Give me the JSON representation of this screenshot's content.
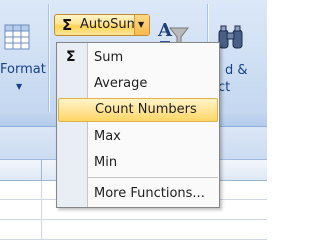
{
  "ribbon": {
    "format_label": "Format",
    "find_select_label_line1": "d &",
    "find_select_label_line2": "ct"
  },
  "autosum": {
    "icon": "sigma-icon",
    "label": "AutoSum"
  },
  "menu": {
    "items": [
      {
        "label": "Sum",
        "icon": "sigma-icon"
      },
      {
        "label": "Average"
      },
      {
        "label": "Count Numbers",
        "highlighted": true
      },
      {
        "label": "Max"
      },
      {
        "label": "Min"
      },
      {
        "label": "More Functions..."
      }
    ]
  },
  "colors": {
    "ribbon": "#c6d9f1",
    "highlight": "#ffe59a",
    "label_blue": "#15428b"
  }
}
